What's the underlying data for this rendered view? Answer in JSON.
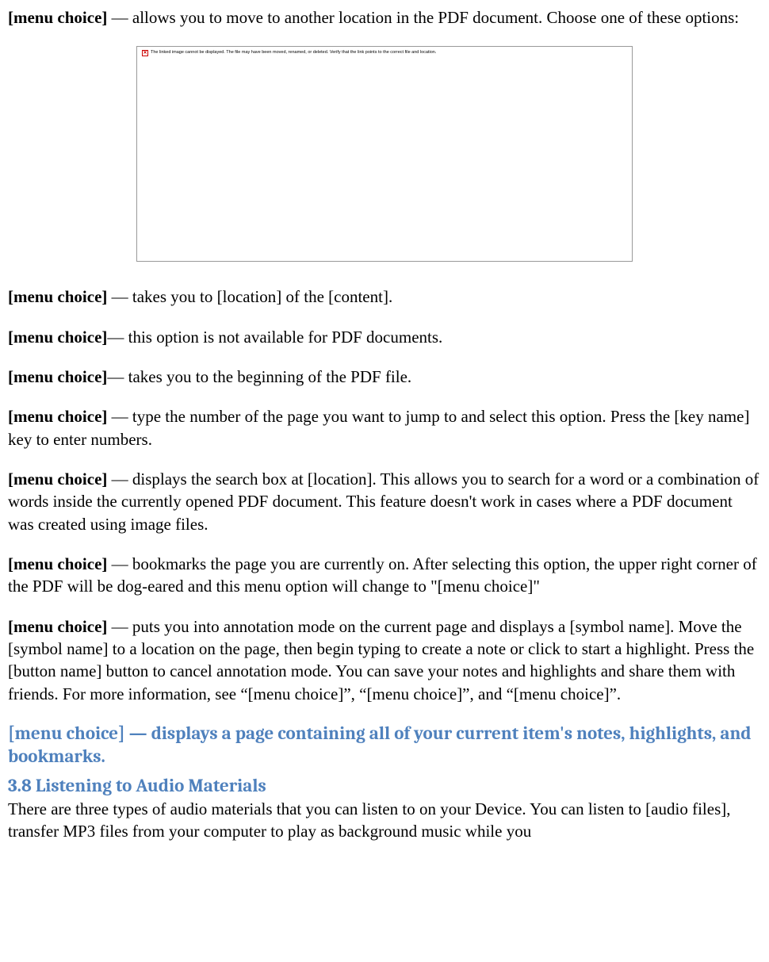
{
  "p1": {
    "bold": "[menu choice]",
    "rest": " — allows you to move to another location in the PDF document. Choose one of these options:"
  },
  "placeholder_text": "The linked image cannot be displayed.  The file may have been moved, renamed, or deleted.  Verify that the link points to the correct file and location.",
  "p2": {
    "bold": "[menu choice]",
    "rest": " — takes you to [location] of the [content]."
  },
  "p3": {
    "bold": "[menu choice]",
    "rest": "— this option is not available for PDF documents."
  },
  "p4": {
    "bold": "[menu choice]",
    "rest": "— takes you to the beginning of the PDF file."
  },
  "p5": {
    "bold": "[menu choice]",
    "rest": " — type the number of the page you want to jump to and select this option. Press the [key name] key to enter numbers."
  },
  "p6": {
    "bold": "[menu choice]",
    "rest": " — displays the search box at [location]. This allows you to search for a word or a combination of words inside the currently opened PDF document. This feature doesn't work in cases where a PDF document was created using image files."
  },
  "p7": {
    "bold": "[menu choice]",
    "rest": " — bookmarks the page you are currently on. After selecting this option, the upper right corner of the PDF will be dog-eared and this menu option will change to \"[menu choice]\""
  },
  "p8": {
    "bold": "[menu choice]",
    "rest": " — puts you into annotation mode on the current page and displays a [symbol name]. Move the [symbol name] to a location on the page, then begin typing to create a note or click to start a highlight.  Press the [button name] button to cancel annotation mode. You can save your notes and highlights and share them with friends. For more information, see “[menu choice]”, “[menu choice]”, and “[menu choice]”."
  },
  "h1": "[menu choice] — displays a page containing all of your current item's notes, highlights, and bookmarks.",
  "h2": "3.8 Listening to Audio Materials",
  "p9": "There are three types of audio materials that you can listen to on your Device. You can listen to [audio files], transfer MP3 files from your computer to play as background music while you"
}
